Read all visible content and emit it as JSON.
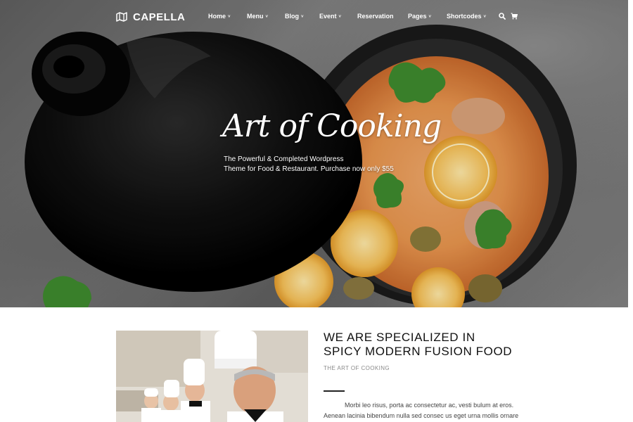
{
  "brand": {
    "name": "CAPELLA",
    "icon": "map-icon"
  },
  "nav": {
    "items": [
      {
        "label": "Home",
        "has_dropdown": true
      },
      {
        "label": "Menu",
        "has_dropdown": true
      },
      {
        "label": "Blog",
        "has_dropdown": true
      },
      {
        "label": "Event",
        "has_dropdown": true
      },
      {
        "label": "Reservation",
        "has_dropdown": false
      },
      {
        "label": "Pages",
        "has_dropdown": true
      },
      {
        "label": "Shortcodes",
        "has_dropdown": true
      }
    ],
    "chevron": "˅",
    "tools": [
      "search-icon",
      "cart-icon"
    ]
  },
  "hero": {
    "title": "Art of Cooking",
    "subtitle_line1": "The Powerful & Completed Wordpress",
    "subtitle_line2": "Theme for Food & Restaurant. Purchase now only $55"
  },
  "about": {
    "title_line1": "WE ARE SPECIALIZED IN",
    "title_line2": "SPICY MODERN FUSION FOOD",
    "subtitle": "THE ART OF COOKING",
    "body_line1": "Morbi leo risus, porta ac consectetur ac, vesti bulum at eros.",
    "body_line2": "Aenean lacinia bibendum nulla sed consec us eget urna mollis ornare"
  },
  "colors": {
    "accent": "#ffffff",
    "text_dark": "#111111",
    "muted": "#8a8a8a"
  }
}
